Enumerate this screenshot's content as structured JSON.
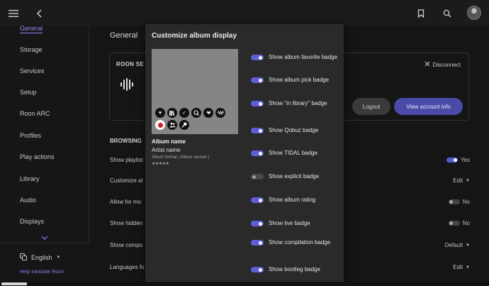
{
  "topbar": {
    "menu_icon": "hamburger-icon",
    "back_icon": "chevron-left-icon",
    "bookmark_icon": "bookmark-icon",
    "search_icon": "search-icon",
    "avatar_icon": "avatar-icon"
  },
  "sidebar": {
    "items": [
      {
        "label": "General",
        "active": true
      },
      {
        "label": "Storage"
      },
      {
        "label": "Services"
      },
      {
        "label": "Setup"
      },
      {
        "label": "Roon ARC"
      },
      {
        "label": "Profiles"
      },
      {
        "label": "Play actions"
      },
      {
        "label": "Library"
      },
      {
        "label": "Audio"
      },
      {
        "label": "Displays"
      }
    ],
    "language": "English",
    "help_link": "Help translate Roon"
  },
  "main": {
    "title": "General",
    "roon_card": {
      "label": "ROON SE",
      "disconnect": "Disconnect",
      "logout": "Logout",
      "view_account": "View account info"
    },
    "browsing_label": "BROWSING",
    "rows": [
      {
        "label": "Show playlist",
        "value": "Yes",
        "control": "toggle-on"
      },
      {
        "label": "Customize al",
        "value": "Edit",
        "control": "caret"
      },
      {
        "label": "Allow for mo",
        "value": "No",
        "control": "toggle-off"
      },
      {
        "label": "Show hidden",
        "value": "No",
        "control": "toggle-off"
      },
      {
        "label": "Show compo",
        "value": "Default",
        "control": "caret"
      },
      {
        "label": "Languages fo",
        "value": "Edit",
        "control": "caret"
      }
    ]
  },
  "modal": {
    "title": "Customize album display",
    "preview": {
      "album_name": "Album name",
      "artist_name": "Artist name",
      "meta": "Album format | Album version |",
      "stars": "★★★★★",
      "badges_row1": [
        "heart-icon",
        "library-icon",
        "check-icon",
        "qobuz-icon",
        "tidal-icon",
        "waveform-icon"
      ],
      "badges_row2": [
        "explicit-icon",
        "compilation-icon",
        "live-icon"
      ]
    },
    "options": [
      {
        "label": "Show album favorite badge",
        "on": true
      },
      {
        "label": "Show album pick badge",
        "on": true
      },
      {
        "label": "Show \"in library\" badge",
        "on": true
      },
      {
        "label": "Show Qobuz badge",
        "on": true
      },
      {
        "label": "Show TIDAL badge",
        "on": true
      },
      {
        "label": "Show explicit badge",
        "on": false
      },
      {
        "label": "Show album rating",
        "on": true
      },
      {
        "label": "Show live badge",
        "on": true
      },
      {
        "label": "Show compilation badge",
        "on": true
      },
      {
        "label": "Show bootleg badge",
        "on": true
      }
    ]
  }
}
